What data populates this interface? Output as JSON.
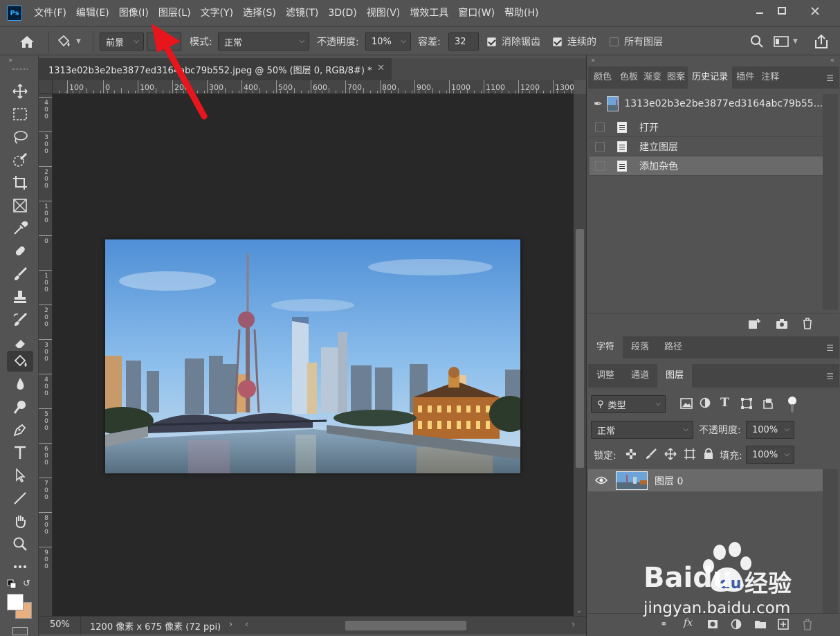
{
  "app": {
    "logo": "Ps"
  },
  "menu": [
    "文件(F)",
    "编辑(E)",
    "图像(I)",
    "图层(L)",
    "文字(Y)",
    "选择(S)",
    "滤镜(T)",
    "3D(D)",
    "视图(V)",
    "增效工具",
    "窗口(W)",
    "帮助(H)"
  ],
  "options": {
    "fill_source": "前景",
    "mode_label": "模式:",
    "mode_value": "正常",
    "opacity_label": "不透明度:",
    "opacity_value": "10%",
    "tolerance_label": "容差:",
    "tolerance_value": "32",
    "antialias_label": "消除锯齿",
    "antialias_checked": true,
    "contiguous_label": "连续的",
    "contiguous_checked": true,
    "all_layers_label": "所有图层",
    "all_layers_checked": false
  },
  "document": {
    "tab_title": "1313e02b3e2be3877ed3164abc79b552.jpeg @ 50% (图层 0, RGB/8#) *",
    "zoom": "50%",
    "info": "1200 像素 x 675 像素 (72 ppi)"
  },
  "rulers": {
    "h": [
      "100",
      "0",
      "100",
      "200",
      "300",
      "400",
      "500",
      "600",
      "700",
      "800",
      "900",
      "1000",
      "1100",
      "1200",
      "1300"
    ],
    "v": [
      "400",
      "300",
      "200",
      "100",
      "0",
      "100",
      "200",
      "300",
      "400",
      "500",
      "600",
      "700",
      "800",
      "900"
    ]
  },
  "top_panel": {
    "tabs": [
      "颜色",
      "色板",
      "渐变",
      "图案",
      "历史记录",
      "插件",
      "注释"
    ],
    "active": "历史记录",
    "snapshot_name": "1313e02b3e2be3877ed3164abc79b55...",
    "history": [
      "打开",
      "建立图层",
      "添加杂色"
    ],
    "selected_history": "添加杂色"
  },
  "mid_panel": {
    "tabs": [
      "字符",
      "段落",
      "路径"
    ],
    "active": "字符"
  },
  "layers_panel": {
    "tabs": [
      "调整",
      "通道",
      "图层"
    ],
    "active": "图层",
    "filter_label": "类型",
    "blend_mode": "正常",
    "opacity_label": "不透明度:",
    "opacity_value": "100%",
    "lock_label": "锁定:",
    "fill_label": "填充:",
    "fill_value": "100%",
    "layers": [
      {
        "name": "图层 0",
        "visible": true
      }
    ]
  },
  "watermark": {
    "brand": "Baidu",
    "cn": "经验",
    "url": "jingyan.baidu.com"
  },
  "colors": {
    "accent": "#31a8ff",
    "arrow": "#e8161c",
    "bg_dark": "#282828",
    "panel": "#535353"
  }
}
